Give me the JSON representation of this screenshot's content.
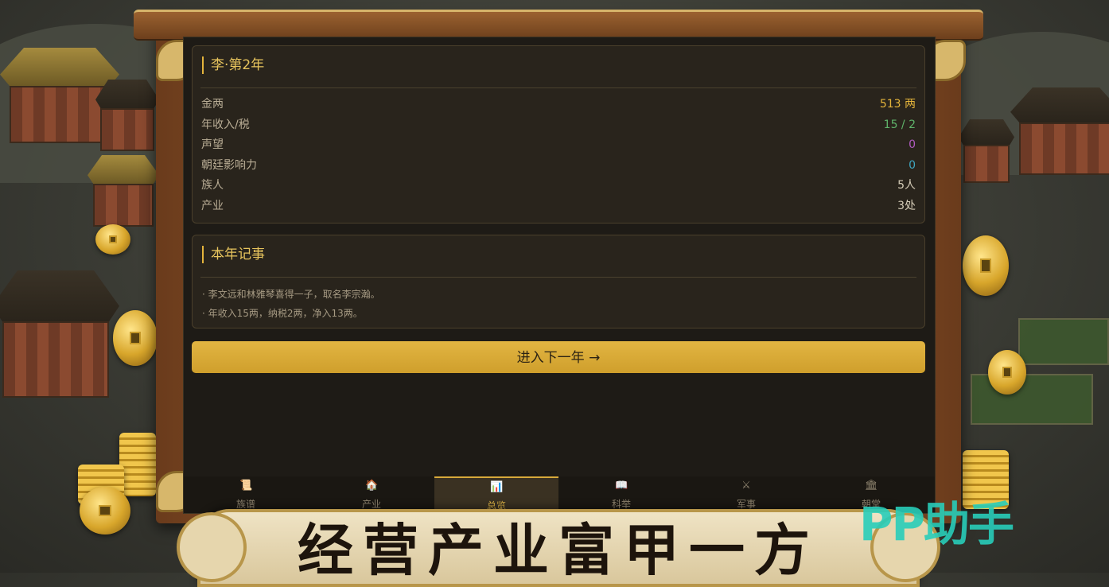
{
  "overview": {
    "title": "李·第2年",
    "stats": [
      {
        "label": "金两",
        "value": "513 两",
        "color": "#e4b43b"
      },
      {
        "label": "年收入/税",
        "value": "15 / 2",
        "color": "#5fb36a"
      },
      {
        "label": "声望",
        "value": "0",
        "color": "#b05bc0"
      },
      {
        "label": "朝廷影响力",
        "value": "0",
        "color": "#3fa6c0"
      },
      {
        "label": "族人",
        "value": "5人",
        "color": "#d6cdb8"
      },
      {
        "label": "产业",
        "value": "3处",
        "color": "#d6cdb8"
      }
    ]
  },
  "events": {
    "title": "本年记事",
    "items": [
      "· 李文远和林雅琴喜得一子，取名李宗瀚。",
      "· 年收入15两，纳税2两，净入13两。"
    ]
  },
  "next_year_button": "进入下一年 →",
  "tabs": [
    {
      "icon": "scroll-icon",
      "glyph": "📜",
      "label": "族谱"
    },
    {
      "icon": "house-icon",
      "glyph": "🏠",
      "label": "产业"
    },
    {
      "icon": "chart-icon",
      "glyph": "📊",
      "label": "总览",
      "active": true
    },
    {
      "icon": "book-icon",
      "glyph": "📖",
      "label": "科举"
    },
    {
      "icon": "swords-icon",
      "glyph": "⚔",
      "label": "军事"
    },
    {
      "icon": "bank-icon",
      "glyph": "🏛",
      "label": "朝堂"
    }
  ],
  "banner": "经营产业富甲一方",
  "watermark": "PP助手"
}
